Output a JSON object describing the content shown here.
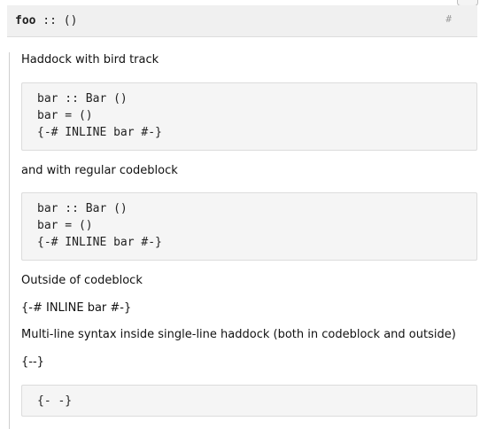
{
  "declaration": {
    "name": "foo",
    "type_sig": " :: ()",
    "anchor": "#"
  },
  "doc": {
    "para_bird_track": "Haddock with bird track",
    "code_bird_track": [
      "bar :: Bar ()",
      "bar = ()",
      "{-# INLINE bar #-}"
    ],
    "para_regular": "and with regular codeblock",
    "code_regular": [
      "bar :: Bar ()",
      "bar = ()",
      "{-# INLINE bar #-}"
    ],
    "para_outside": "Outside of codeblock",
    "pragma_outside": "{-# INLINE bar #-}",
    "para_multiline": "Multi-line syntax inside single-line haddock (both in codeblock and outside)",
    "braces_outside": "{--}",
    "code_braces": [
      "{- -}"
    ]
  }
}
